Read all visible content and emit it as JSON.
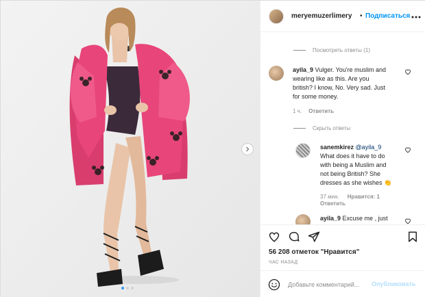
{
  "header": {
    "username": "meryemuzerlimery",
    "bullet": "•",
    "follow_label": "Подписаться",
    "more_icon": "more-dots-icon"
  },
  "comments": {
    "view_replies_label": "Посмотреть ответы (1)",
    "hide_replies_label": "Скрыть ответы",
    "items": [
      {
        "username": "ayila_9",
        "lines": [
          "Vulger. You're muslim and",
          "wearing like as this. Are you",
          "british? I know, No. Very sad. Just",
          "for some money."
        ],
        "time": "1 ч.",
        "reply_label": "Ответить"
      },
      {
        "username": "sanemkirez",
        "mention": "@ayila_9",
        "lines": [
          "What does it have to do",
          "with being a Muslim and",
          "not being British? She",
          "dresses as she wishes 👏"
        ],
        "time": "37 мин.",
        "likes_label": "Нравится: 1",
        "reply_label": "Ответить"
      },
      {
        "username": "ayila_9",
        "text": "Excuse me , just"
      }
    ]
  },
  "actions": {
    "likes_text": "56 208 отметок \"Нравится\"",
    "time_ago": "ЧАС НАЗАД",
    "comment_placeholder": "Добавьте комментарий...",
    "post_label": "Опубликовать"
  },
  "colors": {
    "accent": "#0095f6",
    "coat": "#e8457a",
    "muted": "#8e8e8e"
  },
  "carousel": {
    "slide_count": 3,
    "active_index": 0
  }
}
